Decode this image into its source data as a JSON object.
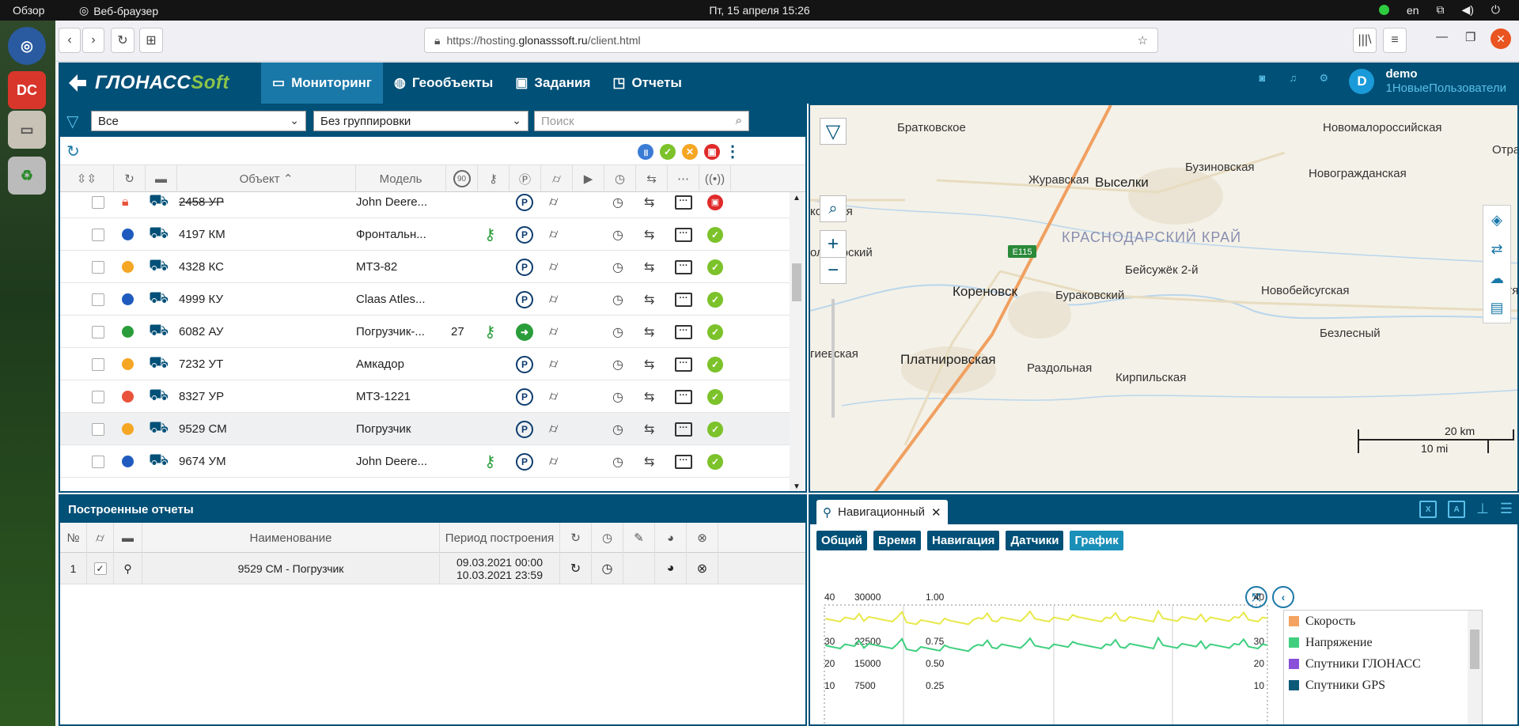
{
  "os": {
    "activities": "Обзор",
    "app_name": "Веб-браузер",
    "clock": "Пт, 15 апреля  15:26",
    "lang": "en"
  },
  "browser": {
    "url_scheme": "https://hosting.",
    "url_host": "glonasssoft.ru",
    "url_path": "/client.html"
  },
  "app": {
    "logo_main": "ГЛОНАСС",
    "logo_soft": "Soft",
    "nav": [
      {
        "label": "Мониторинг"
      },
      {
        "label": "Геообъекты"
      },
      {
        "label": "Задания"
      },
      {
        "label": "Отчеты"
      }
    ],
    "user": {
      "name": "demo",
      "group": "1НовыеПользователи",
      "initial": "D"
    }
  },
  "filters": {
    "status": "Все",
    "grouping": "Без группировки",
    "search_placeholder": "Поиск"
  },
  "columns": {
    "object": "Объект ⌃",
    "model": "Модель",
    "speed_limit": "90"
  },
  "objects": [
    {
      "name": "2458 УР",
      "model": "John Deere...",
      "status_color": "#e8533a",
      "locked": true,
      "speed": "",
      "key": false,
      "moving": false,
      "strike": true
    },
    {
      "name": "4197 КМ",
      "model": "Фронтальн...",
      "status_color": "#1f5bbf",
      "locked": false,
      "speed": "",
      "key": true,
      "moving": false
    },
    {
      "name": "4328 КС",
      "model": "МТЗ-82",
      "status_color": "#f5a623",
      "locked": false,
      "speed": "",
      "key": false,
      "moving": false
    },
    {
      "name": "4999 КУ",
      "model": "Claas Atles...",
      "status_color": "#1f5bbf",
      "locked": false,
      "speed": "",
      "key": false,
      "moving": false
    },
    {
      "name": "6082 АУ",
      "model": "Погрузчик-...",
      "status_color": "#2a9d3a",
      "locked": false,
      "speed": "27",
      "key": true,
      "moving": true
    },
    {
      "name": "7232 УТ",
      "model": "Амкадор",
      "status_color": "#f5a623",
      "locked": false,
      "speed": "",
      "key": false,
      "moving": false
    },
    {
      "name": "8327 УР",
      "model": "МТЗ-1221",
      "status_color": "#e8533a",
      "locked": false,
      "speed": "",
      "key": false,
      "moving": false
    },
    {
      "name": "9529 СМ",
      "model": "Погрузчик",
      "status_color": "#f5a623",
      "locked": false,
      "speed": "",
      "key": false,
      "moving": false,
      "selected": true
    },
    {
      "name": "9674 УМ",
      "model": "John Deere...",
      "status_color": "#1f5bbf",
      "locked": false,
      "speed": "",
      "key": true,
      "moving": false
    }
  ],
  "map": {
    "labels": [
      {
        "text": "Братковское",
        "cls": ""
      },
      {
        "text": "Новомалороссийская",
        "cls": ""
      },
      {
        "text": "Отрадн",
        "cls": ""
      },
      {
        "text": "Журавская",
        "cls": ""
      },
      {
        "text": "Выселки",
        "cls": "big"
      },
      {
        "text": "Бузиновская",
        "cls": ""
      },
      {
        "text": "Новогражданская",
        "cls": ""
      },
      {
        "text": "ковская",
        "cls": ""
      },
      {
        "text": "олетарский",
        "cls": ""
      },
      {
        "text": "Бейсужёк 2-й",
        "cls": ""
      },
      {
        "text": "Кореновск",
        "cls": "big"
      },
      {
        "text": "Бураковский",
        "cls": ""
      },
      {
        "text": "Новобейсугская",
        "cls": ""
      },
      {
        "text": "Октябр",
        "cls": ""
      },
      {
        "text": "гиевская",
        "cls": ""
      },
      {
        "text": "Безлесный",
        "cls": ""
      },
      {
        "text": "Платнировская",
        "cls": "big"
      },
      {
        "text": "Раздольная",
        "cls": ""
      },
      {
        "text": "Кирпильская",
        "cls": ""
      }
    ],
    "region": "КРАСНОДАРСКИЙ КРАЙ",
    "road_label": "E115",
    "scale_km": "20 km",
    "scale_mi": "10 mi"
  },
  "reports": {
    "title": "Построенные отчеты",
    "col_num": "№",
    "col_name": "Наименование",
    "col_period": "Период построения",
    "rows": [
      {
        "num": "1",
        "name": "9529 СМ - Погрузчик",
        "period_from": "09.03.2021 00:00",
        "period_to": "10.03.2021 23:59"
      }
    ]
  },
  "report_view": {
    "tab": "Навигационный",
    "subtabs": [
      "Общий",
      "Время",
      "Навигация",
      "Датчики",
      "График"
    ],
    "axis_labels": {
      "left1": [
        "40",
        "30",
        "20",
        "10"
      ],
      "left2": [
        "30000",
        "22500",
        "15000",
        "7500"
      ],
      "left3": [
        "1.00",
        "0.75",
        "0.50",
        "0.25"
      ],
      "right": [
        "40",
        "30",
        "20",
        "10"
      ]
    },
    "legend": [
      {
        "name": "Скорость",
        "color": "#f4a460"
      },
      {
        "name": "Напряжение",
        "color": "#3fcf7f"
      },
      {
        "name": "Спутники ГЛОНАСС",
        "color": "#8a4fd8"
      },
      {
        "name": "Спутники GPS",
        "color": "#0d5a78"
      }
    ]
  }
}
